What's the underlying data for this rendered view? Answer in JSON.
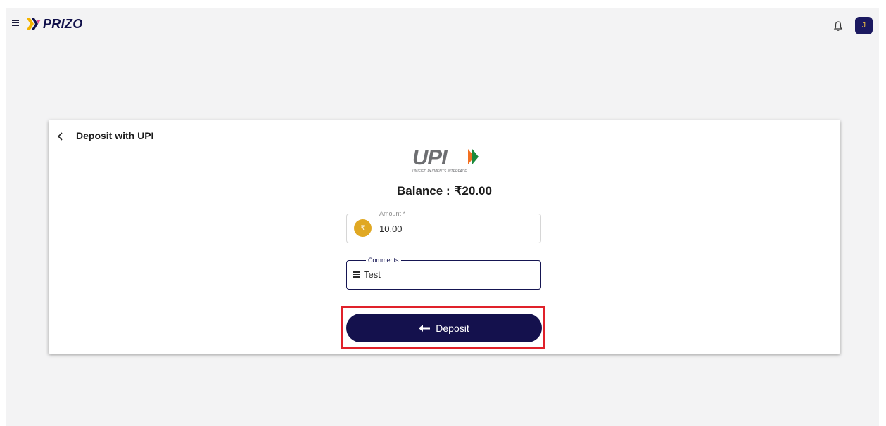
{
  "header": {
    "brand": "PRIZO",
    "avatar_initial": "J",
    "icons": [
      "menu-icon",
      "bell-icon"
    ]
  },
  "card": {
    "title": "Deposit with UPI",
    "upi_logo_text": "UPI",
    "upi_logo_subtitle": "UNIFIED PAYMENTS INTERFACE",
    "balance_label": "Balance :",
    "balance_value": "₹20.00"
  },
  "form": {
    "amount": {
      "label": "Amount *",
      "value": "10.00",
      "currency_symbol": "₹"
    },
    "comments": {
      "label": "Comments",
      "value": "Test"
    },
    "deposit_label": "Deposit"
  },
  "colors": {
    "brand_navy": "#14114d",
    "accent_gold": "#e0a823",
    "highlight_red": "#e0212a",
    "background": "#f3f3f4"
  }
}
